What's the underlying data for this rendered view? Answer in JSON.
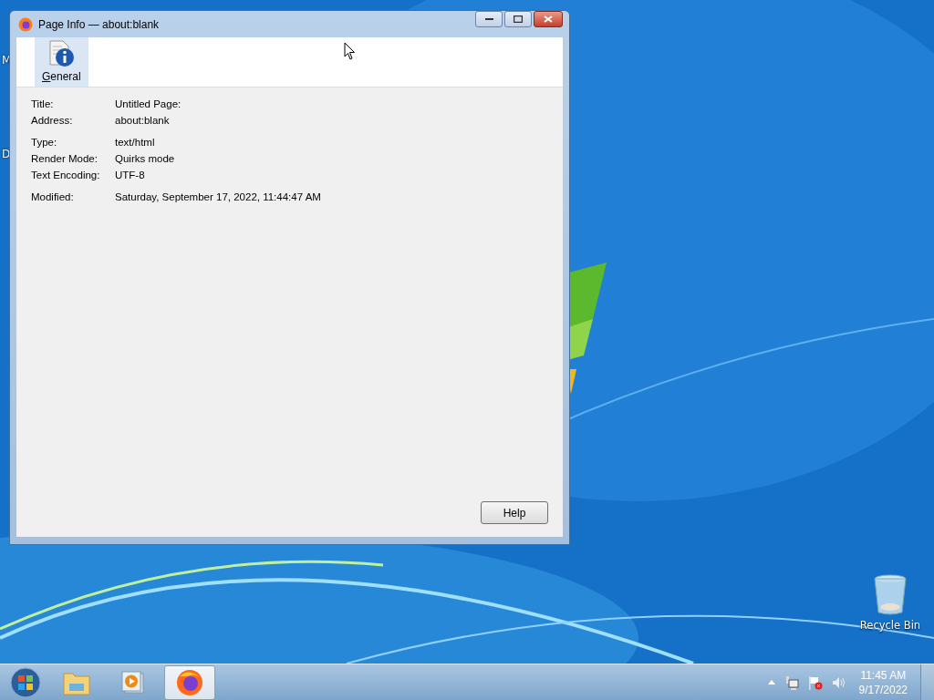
{
  "desktop": {
    "edge_labels": [
      "M",
      "D"
    ],
    "icons": [
      {
        "label": "Recycle Bin"
      }
    ]
  },
  "window": {
    "title": "Page Info — about:blank",
    "tabs": [
      {
        "label": "General",
        "selected": true
      }
    ],
    "field_groups": [
      {
        "fields": [
          {
            "label": "Title:",
            "value": "Untitled Page:"
          },
          {
            "label": "Address:",
            "value": "about:blank"
          }
        ]
      },
      {
        "fields": [
          {
            "label": "Type:",
            "value": "text/html"
          },
          {
            "label": "Render Mode:",
            "value": "Quirks mode"
          },
          {
            "label": "Text Encoding:",
            "value": "UTF-8"
          }
        ]
      },
      {
        "fields": [
          {
            "label": "Modified:",
            "value": "Saturday, September 17, 2022, 11:44:47 AM"
          }
        ]
      }
    ],
    "buttons": [
      "Help"
    ]
  },
  "taskbar": {
    "apps": [
      {
        "kind": "explorer",
        "selected": false
      },
      {
        "kind": "media",
        "selected": false
      },
      {
        "kind": "firefox",
        "selected": true
      }
    ],
    "clock": {
      "time": "11:45 AM",
      "date": "9/17/2022"
    }
  }
}
